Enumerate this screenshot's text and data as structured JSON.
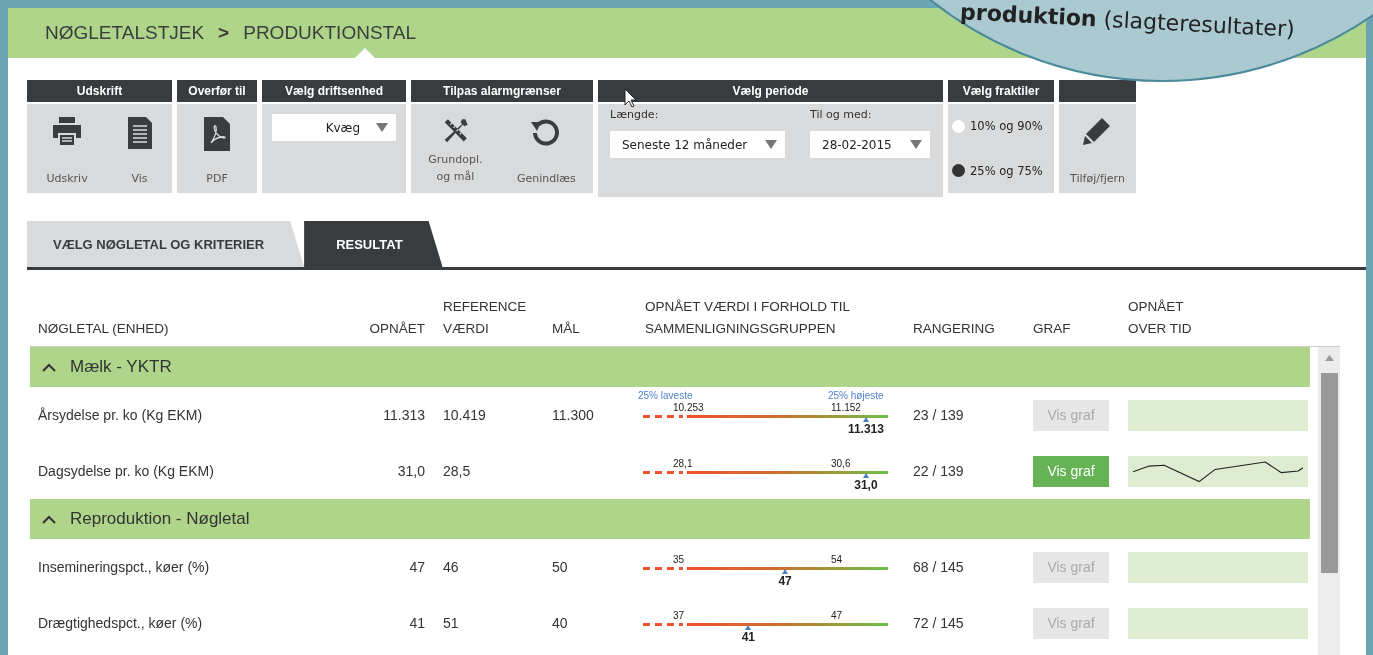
{
  "breadcrumb": {
    "items": [
      "NØGLETALSTJEK",
      "PRODUKTIONSTAL"
    ],
    "separator": ">"
  },
  "callout": {
    "text": "**produktion** (slagteresultater)"
  },
  "toolbar": {
    "print": {
      "header": "Udskrift",
      "buttons": [
        "Udskriv",
        "Vis"
      ]
    },
    "export": {
      "header": "Overfør til",
      "buttons": [
        "PDF"
      ]
    },
    "unit": {
      "header": "Vælg driftsenhed",
      "value": "Kvæg"
    },
    "alarms": {
      "header": "Tilpas alarmgrænser",
      "buttons": [
        "Grundopl.\nog mål",
        "Genindlæs"
      ]
    },
    "period": {
      "header": "Vælg periode",
      "length_label": "Længde:",
      "length_value": "Seneste 12 måneder",
      "to_label": "Til og med:",
      "to_value": "28-02-2015"
    },
    "fractiles": {
      "header": "Vælg fraktiler",
      "options": [
        {
          "label": "10% og 90%",
          "selected": false
        },
        {
          "label": "25% og 75%",
          "selected": true
        }
      ]
    },
    "columns": {
      "button": "Tilføj/fjern"
    }
  },
  "tabs": [
    {
      "label": "VÆLG NØGLETAL OG KRITERIER",
      "selected": false
    },
    {
      "label": "RESULTAT",
      "selected": true
    }
  ],
  "table": {
    "columns": [
      "NØGLETAL (ENHED)",
      "OPNÅET",
      "REFERENCE\nVÆRDI",
      "MÅL",
      "OPNÅET VÆRDI I FORHOLD TIL\nSAMMENLIGNINGSGRUPPEN",
      "RANGERING",
      "GRAF",
      "OPNÅET\nOVER TID"
    ],
    "groups": [
      {
        "title": "Mælk - YKTR",
        "expanded": true,
        "rows": [
          {
            "name": "Årsydelse pr. ko (Kg EKM)",
            "achieved": "11.313",
            "reference": "10.419",
            "goal": "11.300",
            "gauge": {
              "low_caption": "25% laveste",
              "high_caption": "25% højeste",
              "low": "10.253",
              "high": "11.152",
              "value": "11.313",
              "level": 0.91
            },
            "rank": "23 / 139",
            "graph_button": {
              "label": "Vis graf",
              "selected": false
            }
          },
          {
            "name": "Dagsydelse pr. ko (Kg EKM)",
            "achieved": "31,0",
            "reference": "28,5",
            "gauge": {
              "low": "28,1",
              "high": "30,6",
              "value": "31,0",
              "level": 0.91
            },
            "rank": "22 / 139",
            "graph_button": {
              "label": "Vis graf",
              "selected": true
            }
          }
        ]
      },
      {
        "title": "Reproduktion - Nøgletal",
        "expanded": true,
        "rows": [
          {
            "name": "Insemineringspct., køer (%)",
            "achieved": "47",
            "reference": "46",
            "goal": "50",
            "gauge": {
              "low": "35",
              "high": "54",
              "value": "47",
              "level": 0.58
            },
            "rank": "68 / 145",
            "graph_button": {
              "label": "Vis graf",
              "selected": false
            }
          },
          {
            "name": "Drægtighedspct., køer (%)",
            "achieved": "41",
            "reference": "51",
            "goal": "40",
            "gauge": {
              "low": "37",
              "high": "47",
              "value": "41",
              "level": 0.43
            },
            "rank": "72 / 145",
            "graph_button": {
              "label": "Vis graf",
              "selected": false
            }
          }
        ]
      }
    ]
  }
}
